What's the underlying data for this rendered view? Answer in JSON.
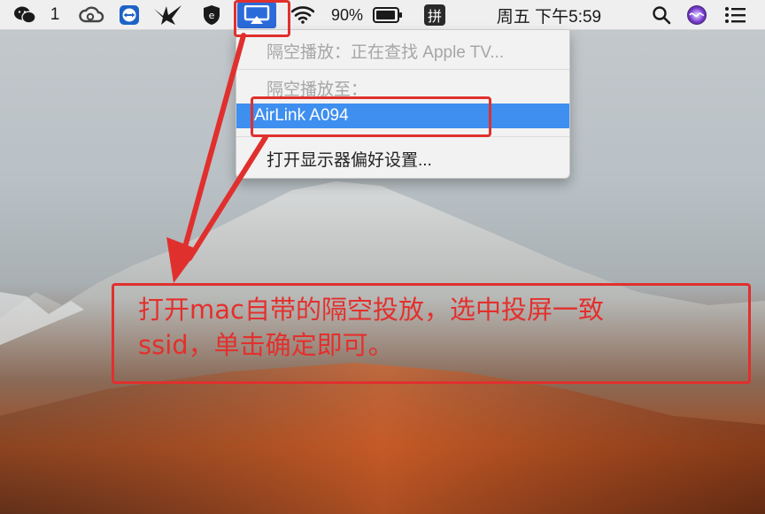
{
  "menubar": {
    "wechat_badge": "1",
    "battery_percent": "90%",
    "input_method": "拼",
    "datetime": "周五 下午5:59"
  },
  "airplay_menu": {
    "searching": "隔空播放：正在查找 Apple TV...",
    "section_header": "隔空播放至：",
    "device": "AirLink A094",
    "display_prefs": "打开显示器偏好设置..."
  },
  "annotation": {
    "line1": "打开mac自带的隔空投放，选中投屏一致",
    "line2": "ssid，单击确定即可。"
  },
  "colors": {
    "menu_highlight": "#3e8ff0",
    "annotation_red": "#e0302e",
    "airplay_active": "#2b6ad9"
  }
}
